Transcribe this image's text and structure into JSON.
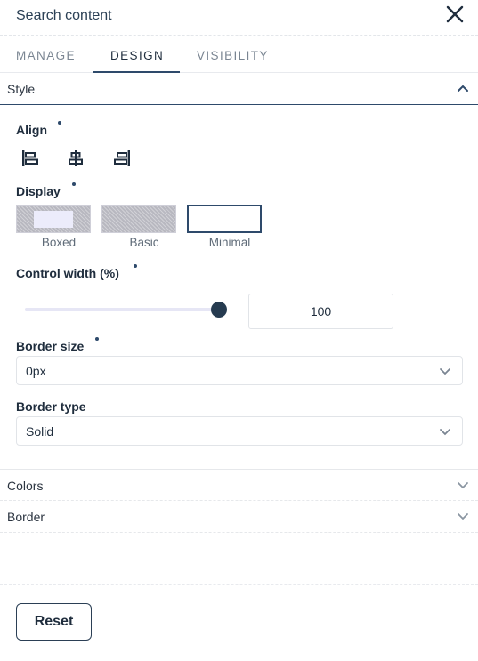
{
  "header": {
    "title": "Search content",
    "close_icon": "close-icon"
  },
  "tabs": [
    {
      "label": "MANAGE",
      "active": false
    },
    {
      "label": "DESIGN",
      "active": true
    },
    {
      "label": "VISIBILITY",
      "active": false
    }
  ],
  "sections": {
    "style": {
      "label": "Style",
      "expanded": true
    },
    "colors": {
      "label": "Colors",
      "expanded": false
    },
    "border": {
      "label": "Border",
      "expanded": false
    }
  },
  "style": {
    "align": {
      "label": "Align",
      "options": [
        "align-left-icon",
        "align-center-icon",
        "align-right-icon"
      ]
    },
    "display": {
      "label": "Display",
      "options": [
        {
          "label": "Boxed"
        },
        {
          "label": "Basic"
        },
        {
          "label": "Minimal",
          "selected": true
        }
      ]
    },
    "control_width": {
      "label": "Control width (%)",
      "value": "100",
      "slider_fraction": 1.0
    },
    "border_size": {
      "label": "Border size",
      "value": "0px"
    },
    "border_type": {
      "label": "Border type",
      "value": "Solid"
    }
  },
  "footer": {
    "reset_label": "Reset"
  },
  "colors": {
    "accent": "#2e4a6b",
    "knob": "#263b50",
    "text": "#1f2d3d"
  }
}
